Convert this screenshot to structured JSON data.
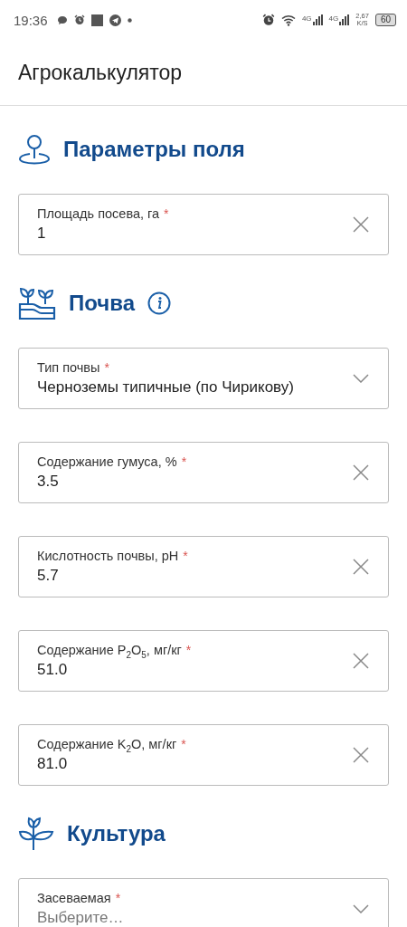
{
  "status_bar": {
    "time": "19:36",
    "network_1": "4G",
    "network_2": "4G",
    "speed": "2,67",
    "speed_unit": "K/S",
    "battery": "60"
  },
  "app_bar": {
    "title": "Агрокалькулятор"
  },
  "sections": [
    {
      "kind": "pin",
      "title": "Параметры поля",
      "info": false,
      "fields": [
        {
          "kind": "text",
          "label": "Площадь посева, га",
          "mark": "*",
          "value": "1"
        }
      ]
    },
    {
      "kind": "soil",
      "title": "Почва",
      "info": true,
      "fields": [
        {
          "kind": "select",
          "label": "Тип почвы",
          "mark": "*",
          "value": "Черноземы типичные (по Чирикову)"
        },
        {
          "kind": "text",
          "label": "Содержание гумуса, %",
          "mark": "*",
          "value": "3.5"
        },
        {
          "kind": "text",
          "label": "Кислотность почвы, pH",
          "mark": "*",
          "value": "5.7"
        },
        {
          "kind": "text",
          "label": "Содержание P$_{2}$O$_{5}$, мг/кг",
          "mark": "*",
          "value": "51.0"
        },
        {
          "kind": "text",
          "label": "Содержание K$_{2}$O, мг/кг",
          "mark": "*",
          "value": "81.0"
        }
      ]
    },
    {
      "kind": "plant",
      "title": "Культура",
      "info": false,
      "fields": [
        {
          "kind": "select",
          "label": "Засеваемая",
          "mark": "*",
          "placeholder": "Выберите…"
        }
      ]
    }
  ]
}
